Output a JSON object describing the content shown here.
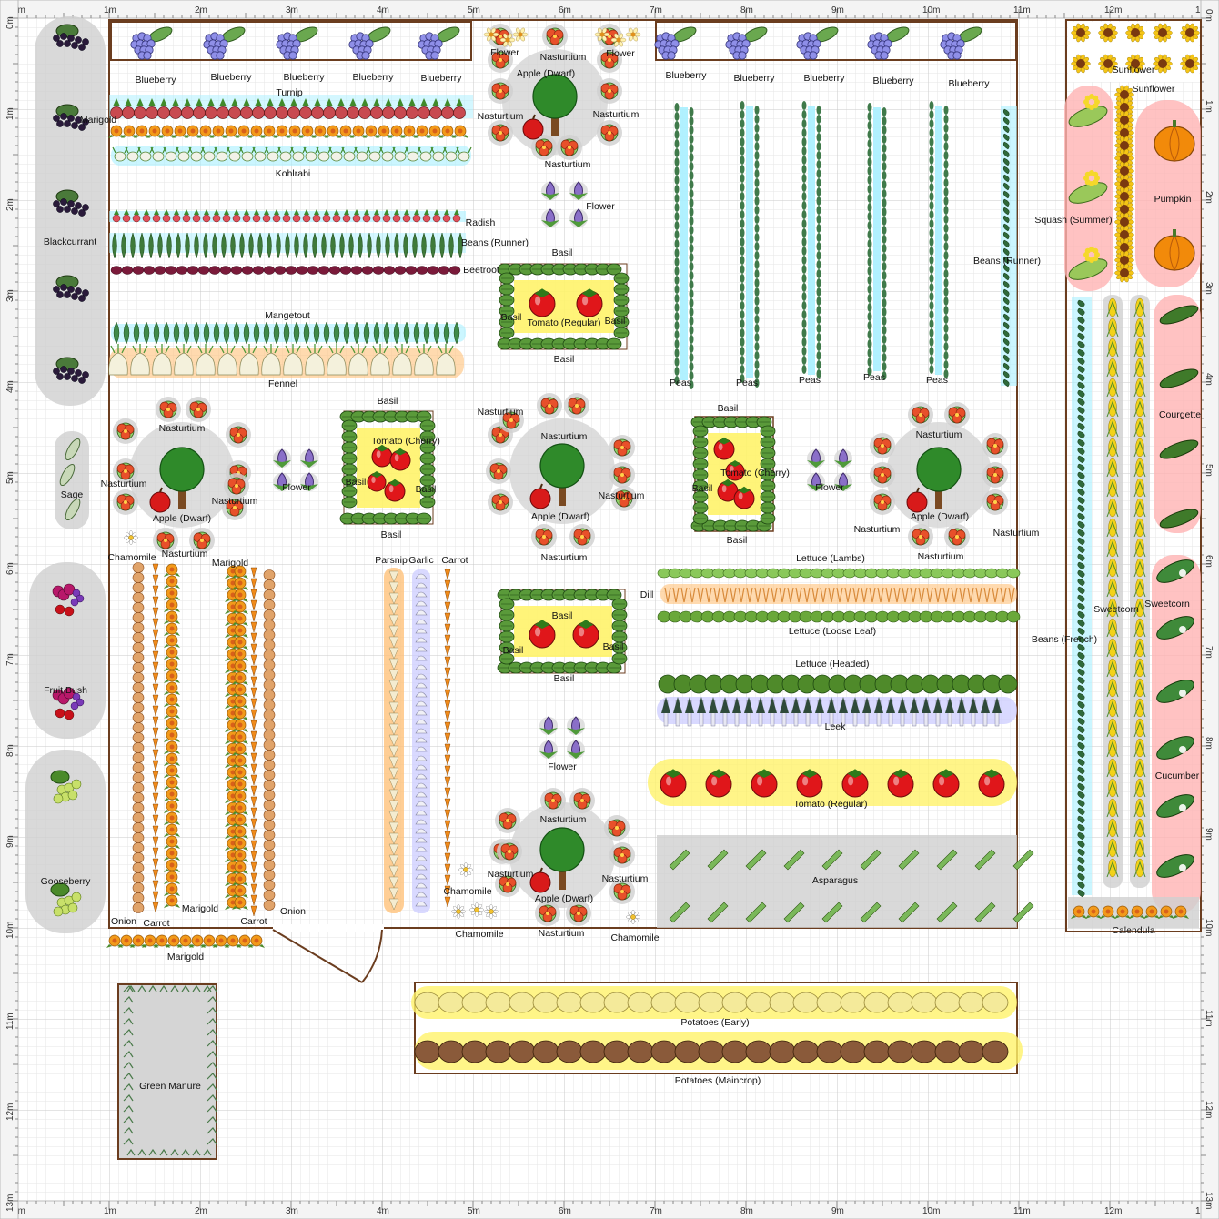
{
  "ruler": {
    "top": [
      "0m",
      "1m",
      "2m",
      "3m",
      "4m",
      "5m",
      "6m",
      "7m",
      "8m",
      "9m",
      "10m",
      "11m",
      "12m",
      "13m"
    ],
    "left": [
      "0m",
      "1m",
      "2m",
      "3m",
      "4m",
      "5m",
      "6m",
      "7m",
      "8m",
      "9m",
      "10m",
      "11m",
      "12m",
      "13m"
    ]
  },
  "colors": {
    "bed_border": "#6b3d1f",
    "grid_minor": "#e6e6e6",
    "grid_major": "#c9c9c9",
    "shade_grey": "#cfcfcf",
    "shade_yellow": "#fff36a",
    "shade_pink": "#ffb3b3",
    "shade_blue": "#a9f0ff",
    "shade_orange": "#ffc27a",
    "shade_lavender": "#c9c9ff",
    "leaf_green": "#3f8a2a"
  },
  "labels": {
    "blueberry": "Blueberry",
    "flower": "Flower",
    "nasturtium": "Nasturtium",
    "apple_dwarf": "Apple (Dwarf)",
    "sunflower": "Sunflower",
    "marigold": "Marigold",
    "turnip": "Turnip",
    "kohlrabi": "Kohlrabi",
    "blackcurrant": "Blackcurrant",
    "radish": "Radish",
    "beans_runner": "Beans (Runner)",
    "beetroot": "Beetroot",
    "basil": "Basil",
    "tomato_regular": "Tomato (Regular)",
    "tomato_cherry_a": "Tomato (Cherry)",
    "tomato_cherry_b": "Tomato (Cherry)",
    "mangetout": "Mangetout",
    "fennel": "Fennel",
    "peas": "Peas",
    "squash_summer": "Squash (Summer)",
    "pumpkin": "Pumpkin",
    "courgette": "Courgette",
    "sage": "Sage",
    "chamomile": "Chamomile",
    "parsnip": "Parsnip",
    "garlic": "Garlic",
    "carrot": "Carrot",
    "onion": "Onion",
    "lettuce_lambs": "Lettuce (Lambs)",
    "dill": "Dill",
    "lettuce_loose": "Lettuce (Loose Leaf)",
    "lettuce_headed": "Lettuce (Headed)",
    "leek": "Leek",
    "sweetcorn": "Sweetcorn",
    "beans_french": "Beans (French)",
    "fruit_bush": "Fruit Bush",
    "gooseberry": "Gooseberry",
    "asparagus": "Asparagus",
    "cucumber": "Cucumber",
    "calendula": "Calendula",
    "green_manure": "Green Manure",
    "potatoes_early": "Potatoes (Early)",
    "potatoes_maincrop": "Potatoes (Maincrop)"
  }
}
